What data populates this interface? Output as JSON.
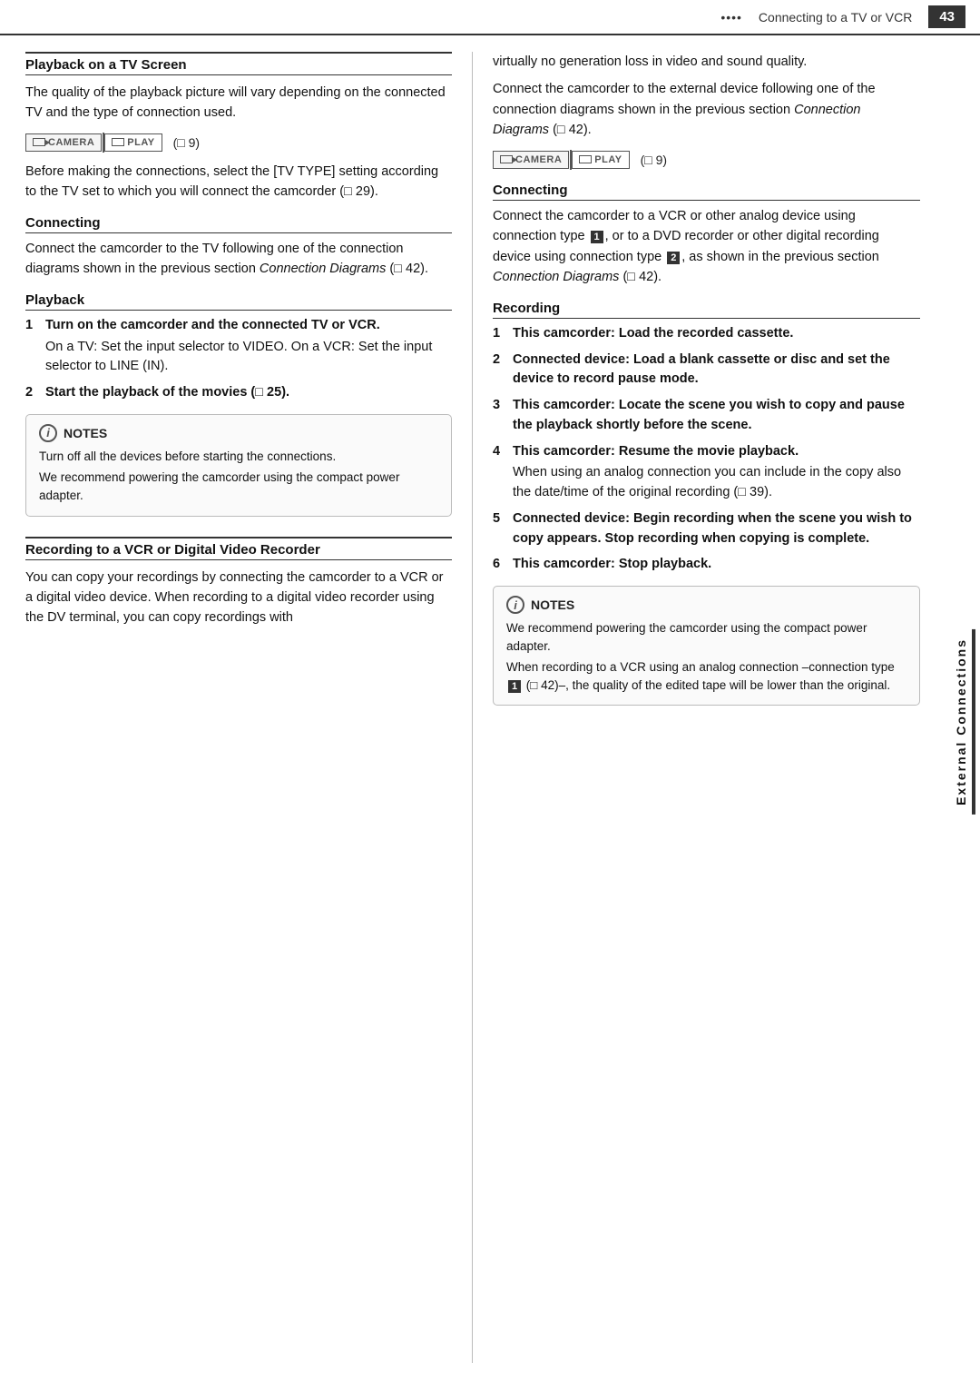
{
  "topbar": {
    "dots": "••••",
    "title": "Connecting to a TV or VCR",
    "page": "43"
  },
  "sidebar": {
    "label": "External Connections"
  },
  "left_col": {
    "section_title": "Playback on a TV Screen",
    "section_title_underline": true,
    "intro_text": "The quality of the playback picture will vary depending on the connected TV and the type of connection used.",
    "mode_ref": "(□ 9)",
    "before_text": "Before making the connections, select the [TV TYPE] setting according to the TV set to which you will connect the camcorder (□ 29).",
    "connecting_title": "Connecting",
    "connecting_text": "Connect the camcorder to the TV following one of the connection diagrams shown in the previous section",
    "connecting_italic": "Connection Diagrams",
    "connecting_ref": "(□ 42).",
    "playback_title": "Playback",
    "steps": [
      {
        "num": "1",
        "bold": "Turn on the camcorder and the connected TV or VCR.",
        "sub": "On a TV: Set the input selector to VIDEO. On a VCR: Set the input selector to LINE (IN)."
      },
      {
        "num": "2",
        "bold": "Start the playback of the movies (□ 25).",
        "sub": ""
      }
    ],
    "notes_header": "NOTES",
    "notes_lines": [
      "Turn off all the devices before starting the connections.",
      "We recommend powering the camcorder using the compact power adapter."
    ],
    "recording_section_title": "Recording to a VCR or Digital Video Recorder",
    "recording_intro": "You can copy your recordings by connecting the camcorder to a VCR or a digital video device. When recording to a digital video recorder using the DV terminal, you can copy recordings with"
  },
  "right_col": {
    "intro_text1": "virtually no generation loss in video and sound quality.",
    "intro_text2": "Connect the camcorder to the external device following one of the connection diagrams shown in the previous section",
    "intro_italic": "Connection Diagrams",
    "intro_ref": "(□ 42).",
    "mode_ref": "(□ 9)",
    "connecting_title": "Connecting",
    "connecting_text": "Connect the camcorder to a VCR or other analog device using connection type",
    "connecting_text2": ", or to a DVD recorder or other digital recording device using connection type",
    "connecting_text3": ", as shown in the previous section",
    "connecting_italic": "Connection Diagrams",
    "connecting_ref": "(□ 42).",
    "recording_title": "Recording",
    "steps": [
      {
        "num": "1",
        "bold": "This camcorder: Load the recorded cassette.",
        "sub": ""
      },
      {
        "num": "2",
        "bold": "Connected device: Load a blank cassette or disc and set the device to record pause mode.",
        "sub": ""
      },
      {
        "num": "3",
        "bold": "This camcorder: Locate the scene you wish to copy and pause the playback shortly before the scene.",
        "sub": ""
      },
      {
        "num": "4",
        "bold": "This camcorder: Resume the movie playback.",
        "sub": "When using an analog connection you can include in the copy also the date/time of the original recording (□ 39)."
      },
      {
        "num": "5",
        "bold": "Connected device: Begin recording when the scene you wish to copy appears. Stop recording when copying is complete.",
        "sub": ""
      },
      {
        "num": "6",
        "bold": "This camcorder: Stop playback.",
        "sub": ""
      }
    ],
    "notes_header": "NOTES",
    "notes_lines": [
      "We recommend powering the camcorder using the compact power adapter.",
      "When recording to a VCR using an analog connection –connection type",
      "(□ 42)–, the quality of the edited tape will be lower than the original."
    ]
  },
  "buttons": {
    "camera_label": "CAMERA",
    "play_label": "PLAY"
  }
}
